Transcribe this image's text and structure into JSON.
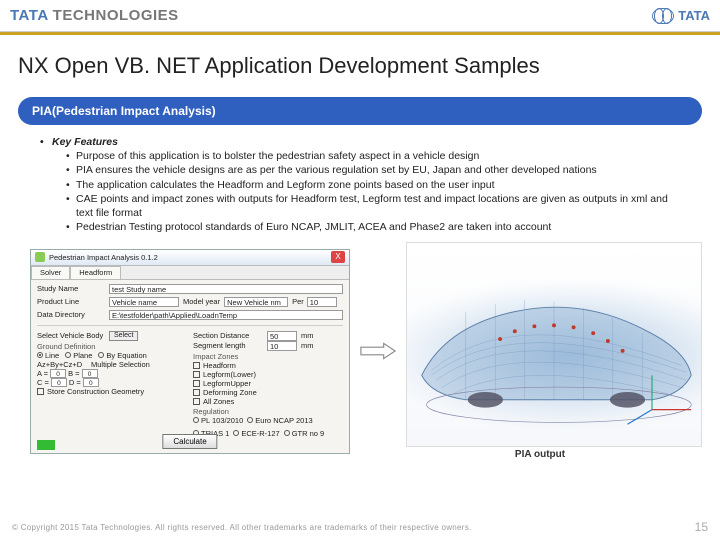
{
  "header": {
    "brand_tata": "TATA",
    "brand_tech": "TECHNOLOGIES",
    "mark_text": "TATA"
  },
  "title": "NX Open VB. NET Application Development Samples",
  "section_pill": "PIA(Pedestrian Impact Analysis)",
  "features": {
    "heading": "Key Features",
    "items": [
      "Purpose of this application is to bolster the pedestrian safety aspect in a vehicle design",
      "PIA ensures the vehicle designs are as per the various regulation set by EU, Japan and other developed nations",
      "The application calculates the Headform and Legform zone points based on the user input",
      "CAE points and impact zones with outputs for Headform test, Legform test and impact locations are given as outputs in xml and text file format",
      "Pedestrian Testing protocol standards of Euro NCAP, JMLIT, ACEA and Phase2 are taken into account"
    ]
  },
  "window": {
    "title": "Pedestrian Impact Analysis 0.1.2",
    "close": "X",
    "tabs": [
      "Solver",
      "Headform"
    ],
    "fields": {
      "study_name_label": "Study Name",
      "study_name_value": "test Study name",
      "product_line_label": "Product Line",
      "product_line_value": "Vehicle name",
      "model_year_label": "Model year",
      "model_year_value": "New Vehicle nm",
      "percentile_label": "Per",
      "percentile_value": "10",
      "data_dir_label": "Data Directory",
      "data_dir_value": "E:\\testfolder\\path\\Applied\\LoadnTemp",
      "select_vehicle_label": "Select Vehicle Body",
      "button_select": "Select",
      "section_distance_label": "Section Distance",
      "section_distance_value": "50",
      "section_distance_unit": "mm",
      "segment_length_label": "Segment length",
      "segment_length_value": "10",
      "segment_length_unit": "mm",
      "ground_def_label": "Ground Definition",
      "ground_radios": [
        "Line",
        "Plane",
        "By Equation"
      ],
      "eq_label": "Az+By+Cz+D",
      "eq_a": "A =",
      "eq_b": "B =",
      "eq_c": "C =",
      "eq_d": "D =",
      "eq_a_v": "0",
      "eq_b_v": "0",
      "eq_c_v": "0",
      "eq_d_v": "0",
      "store_label": "Store Construction Geometry",
      "multisel_label": "Multiple Selection",
      "impact_label": "Impact Zones",
      "impact_opts": [
        "Headform",
        "Legform(Lower)",
        "LegformUpper",
        "Deforming Zone",
        "All Zones"
      ],
      "regulation_label": "Regulation",
      "reg_opts": [
        "PL 103/2010",
        "Euro NCAP 2013",
        "TRIAS 1",
        "ECE-R-127",
        "GTR no 9"
      ]
    },
    "calculate": "Calculate"
  },
  "caption": "PIA output",
  "footer": {
    "copyright": "© Copyright 2015 Tata Technologies. All rights reserved. All other trademarks are trademarks of their respective owners.",
    "page": "15"
  },
  "colors": {
    "accent_blue": "#2f5fbf",
    "gold": "#c9a227"
  }
}
